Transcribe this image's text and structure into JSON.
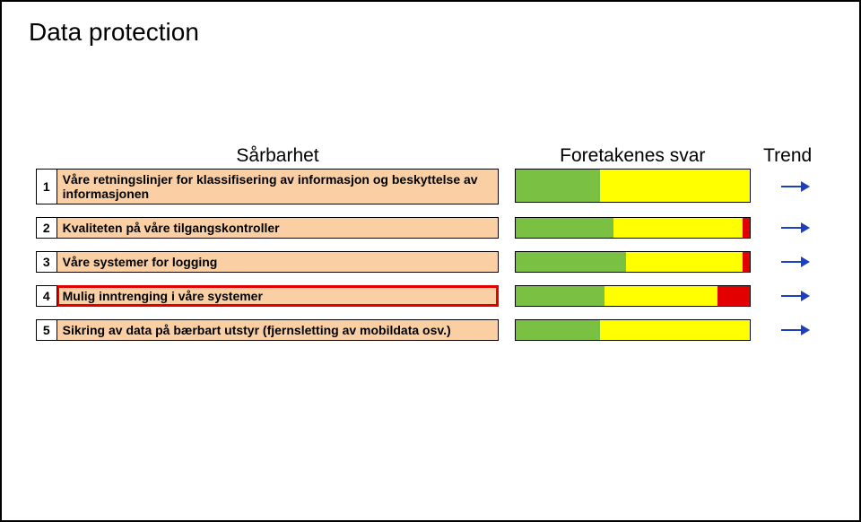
{
  "title": "Data protection",
  "headers": {
    "vulnerability": "Sårbarhet",
    "responses": "Foretakenes svar",
    "trend": "Trend"
  },
  "rows": [
    {
      "num": "1",
      "text": "Våre retningslinjer for klassifisering av informasjon og beskyttelse av informasjonen",
      "tall": true,
      "highlight": false,
      "bar": {
        "green": 36,
        "yellow": 64,
        "red": 0
      }
    },
    {
      "num": "2",
      "text": "Kvaliteten på våre tilgangskontroller",
      "tall": false,
      "highlight": false,
      "bar": {
        "green": 42,
        "yellow": 55,
        "red": 3
      }
    },
    {
      "num": "3",
      "text": "Våre systemer for logging",
      "tall": false,
      "highlight": false,
      "bar": {
        "green": 47,
        "yellow": 50,
        "red": 3
      }
    },
    {
      "num": "4",
      "text": "Mulig inntrenging i våre systemer",
      "tall": false,
      "highlight": true,
      "bar": {
        "green": 38,
        "yellow": 48,
        "red": 14
      }
    },
    {
      "num": "5",
      "text": "Sikring av data på bærbart utstyr (fjernsletting av mobildata osv.)",
      "tall": false,
      "highlight": false,
      "bar": {
        "green": 36,
        "yellow": 64,
        "red": 0
      }
    }
  ]
}
